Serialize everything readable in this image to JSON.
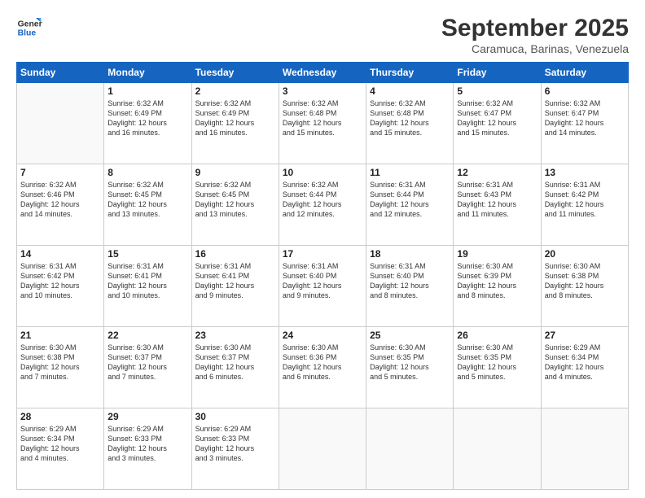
{
  "logo": {
    "line1": "General",
    "line2": "Blue"
  },
  "title": "September 2025",
  "subtitle": "Caramuca, Barinas, Venezuela",
  "days_header": [
    "Sunday",
    "Monday",
    "Tuesday",
    "Wednesday",
    "Thursday",
    "Friday",
    "Saturday"
  ],
  "weeks": [
    [
      {
        "day": "",
        "info": ""
      },
      {
        "day": "1",
        "info": "Sunrise: 6:32 AM\nSunset: 6:49 PM\nDaylight: 12 hours\nand 16 minutes."
      },
      {
        "day": "2",
        "info": "Sunrise: 6:32 AM\nSunset: 6:49 PM\nDaylight: 12 hours\nand 16 minutes."
      },
      {
        "day": "3",
        "info": "Sunrise: 6:32 AM\nSunset: 6:48 PM\nDaylight: 12 hours\nand 15 minutes."
      },
      {
        "day": "4",
        "info": "Sunrise: 6:32 AM\nSunset: 6:48 PM\nDaylight: 12 hours\nand 15 minutes."
      },
      {
        "day": "5",
        "info": "Sunrise: 6:32 AM\nSunset: 6:47 PM\nDaylight: 12 hours\nand 15 minutes."
      },
      {
        "day": "6",
        "info": "Sunrise: 6:32 AM\nSunset: 6:47 PM\nDaylight: 12 hours\nand 14 minutes."
      }
    ],
    [
      {
        "day": "7",
        "info": "Sunrise: 6:32 AM\nSunset: 6:46 PM\nDaylight: 12 hours\nand 14 minutes."
      },
      {
        "day": "8",
        "info": "Sunrise: 6:32 AM\nSunset: 6:45 PM\nDaylight: 12 hours\nand 13 minutes."
      },
      {
        "day": "9",
        "info": "Sunrise: 6:32 AM\nSunset: 6:45 PM\nDaylight: 12 hours\nand 13 minutes."
      },
      {
        "day": "10",
        "info": "Sunrise: 6:32 AM\nSunset: 6:44 PM\nDaylight: 12 hours\nand 12 minutes."
      },
      {
        "day": "11",
        "info": "Sunrise: 6:31 AM\nSunset: 6:44 PM\nDaylight: 12 hours\nand 12 minutes."
      },
      {
        "day": "12",
        "info": "Sunrise: 6:31 AM\nSunset: 6:43 PM\nDaylight: 12 hours\nand 11 minutes."
      },
      {
        "day": "13",
        "info": "Sunrise: 6:31 AM\nSunset: 6:42 PM\nDaylight: 12 hours\nand 11 minutes."
      }
    ],
    [
      {
        "day": "14",
        "info": "Sunrise: 6:31 AM\nSunset: 6:42 PM\nDaylight: 12 hours\nand 10 minutes."
      },
      {
        "day": "15",
        "info": "Sunrise: 6:31 AM\nSunset: 6:41 PM\nDaylight: 12 hours\nand 10 minutes."
      },
      {
        "day": "16",
        "info": "Sunrise: 6:31 AM\nSunset: 6:41 PM\nDaylight: 12 hours\nand 9 minutes."
      },
      {
        "day": "17",
        "info": "Sunrise: 6:31 AM\nSunset: 6:40 PM\nDaylight: 12 hours\nand 9 minutes."
      },
      {
        "day": "18",
        "info": "Sunrise: 6:31 AM\nSunset: 6:40 PM\nDaylight: 12 hours\nand 8 minutes."
      },
      {
        "day": "19",
        "info": "Sunrise: 6:30 AM\nSunset: 6:39 PM\nDaylight: 12 hours\nand 8 minutes."
      },
      {
        "day": "20",
        "info": "Sunrise: 6:30 AM\nSunset: 6:38 PM\nDaylight: 12 hours\nand 8 minutes."
      }
    ],
    [
      {
        "day": "21",
        "info": "Sunrise: 6:30 AM\nSunset: 6:38 PM\nDaylight: 12 hours\nand 7 minutes."
      },
      {
        "day": "22",
        "info": "Sunrise: 6:30 AM\nSunset: 6:37 PM\nDaylight: 12 hours\nand 7 minutes."
      },
      {
        "day": "23",
        "info": "Sunrise: 6:30 AM\nSunset: 6:37 PM\nDaylight: 12 hours\nand 6 minutes."
      },
      {
        "day": "24",
        "info": "Sunrise: 6:30 AM\nSunset: 6:36 PM\nDaylight: 12 hours\nand 6 minutes."
      },
      {
        "day": "25",
        "info": "Sunrise: 6:30 AM\nSunset: 6:35 PM\nDaylight: 12 hours\nand 5 minutes."
      },
      {
        "day": "26",
        "info": "Sunrise: 6:30 AM\nSunset: 6:35 PM\nDaylight: 12 hours\nand 5 minutes."
      },
      {
        "day": "27",
        "info": "Sunrise: 6:29 AM\nSunset: 6:34 PM\nDaylight: 12 hours\nand 4 minutes."
      }
    ],
    [
      {
        "day": "28",
        "info": "Sunrise: 6:29 AM\nSunset: 6:34 PM\nDaylight: 12 hours\nand 4 minutes."
      },
      {
        "day": "29",
        "info": "Sunrise: 6:29 AM\nSunset: 6:33 PM\nDaylight: 12 hours\nand 3 minutes."
      },
      {
        "day": "30",
        "info": "Sunrise: 6:29 AM\nSunset: 6:33 PM\nDaylight: 12 hours\nand 3 minutes."
      },
      {
        "day": "",
        "info": ""
      },
      {
        "day": "",
        "info": ""
      },
      {
        "day": "",
        "info": ""
      },
      {
        "day": "",
        "info": ""
      }
    ]
  ]
}
